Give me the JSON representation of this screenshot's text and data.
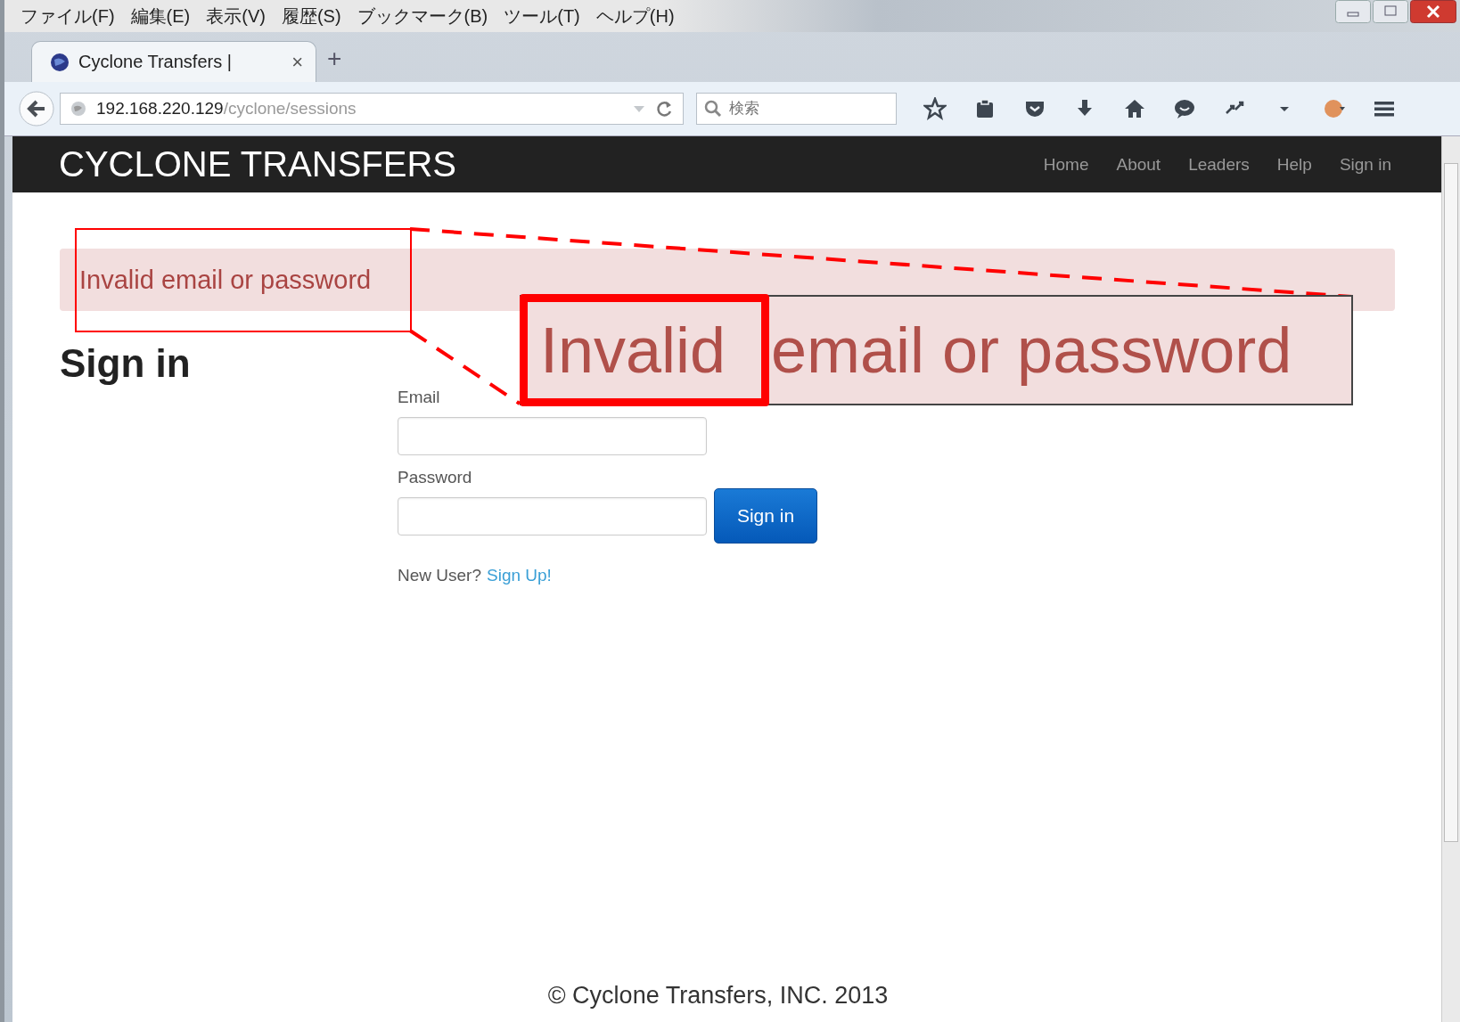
{
  "menu_bar": [
    "ファイル(F)",
    "編集(E)",
    "表示(V)",
    "履歴(S)",
    "ブックマーク(B)",
    "ツール(T)",
    "ヘルプ(H)"
  ],
  "tab": {
    "title": "Cyclone Transfers |",
    "close": "×",
    "new_tab": "+"
  },
  "address_bar": {
    "host": "192.168.220.129",
    "path": "/cyclone/sessions"
  },
  "search": {
    "placeholder": "検索"
  },
  "site": {
    "brand": "CYCLONE TRANSFERS",
    "nav": [
      "Home",
      "About",
      "Leaders",
      "Help",
      "Sign in"
    ]
  },
  "alert": {
    "text": "Invalid email or password"
  },
  "form": {
    "heading": "Sign in",
    "fields": [
      {
        "label": "Email"
      },
      {
        "label": "Password"
      }
    ],
    "button": "Sign in",
    "new_user": "New User?",
    "signup_link": "Sign Up!"
  },
  "footer": "© Cyclone Transfers, INC. 2013",
  "annotation": {
    "callout_parts": [
      {
        "text": "Invalid",
        "highlighted": true
      },
      {
        "text": "email or password",
        "highlighted": false
      }
    ]
  }
}
